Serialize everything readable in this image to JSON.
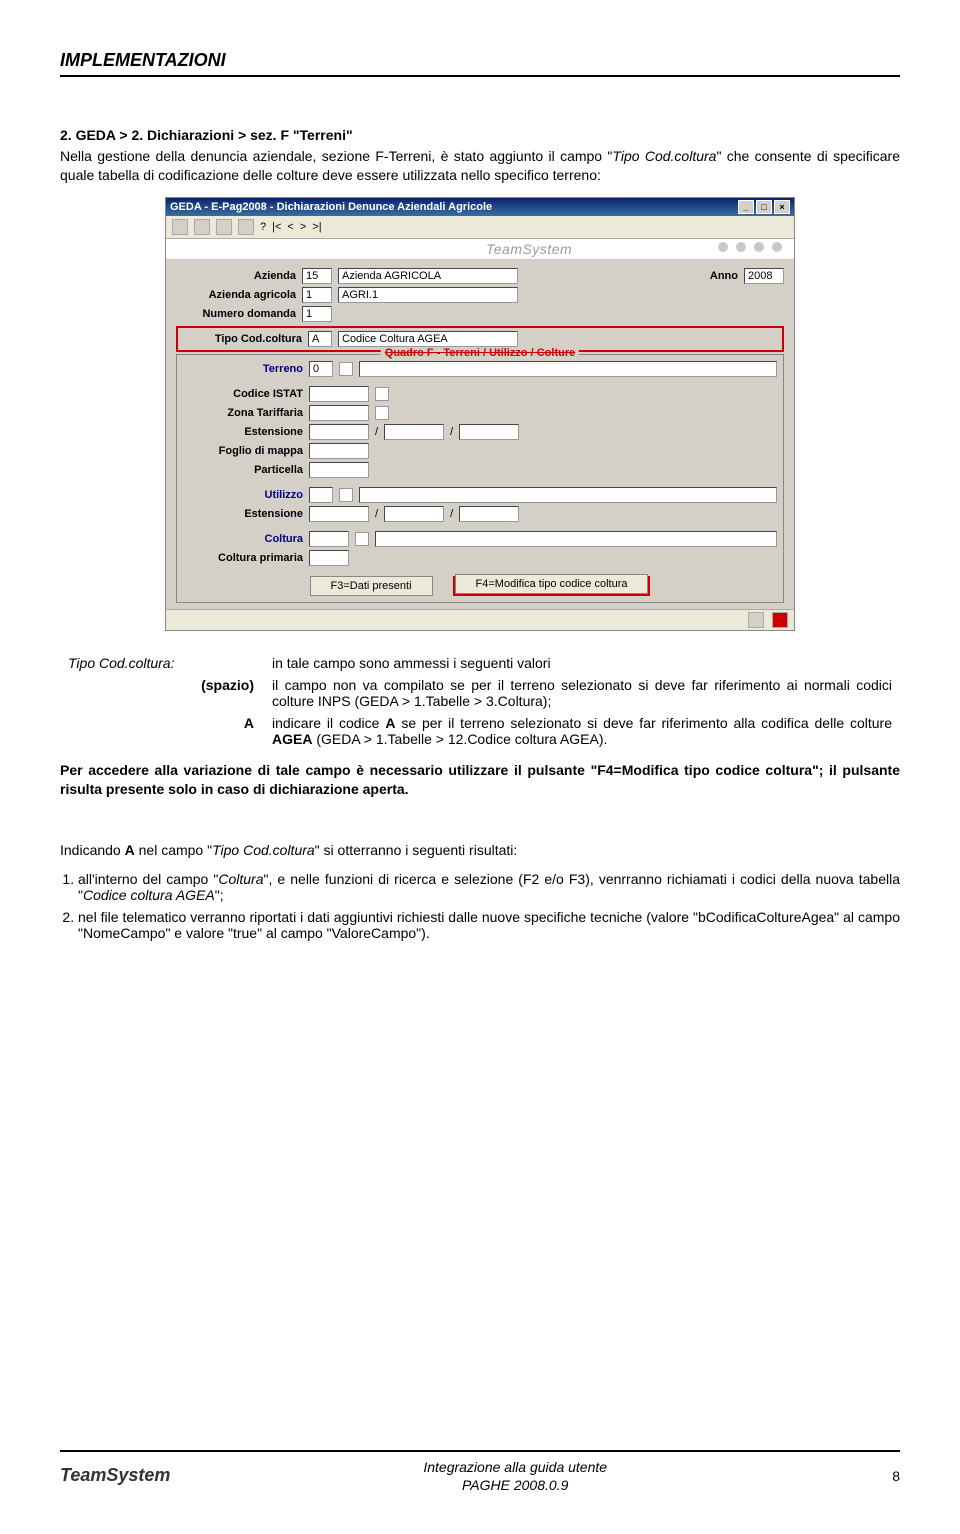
{
  "header": "IMPLEMENTAZIONI",
  "section_title": "2. GEDA > 2. Dichiarazioni > sez. F \"Terreni\"",
  "intro_1": "Nella gestione della denuncia aziendale, sezione F-Terreni, è stato aggiunto il campo \"",
  "intro_field": "Tipo Cod.coltura",
  "intro_2": "\" che consente di specificare quale tabella di codificazione delle colture deve essere utilizzata nello specifico terreno:",
  "win": {
    "title": "GEDA  - E-Pag2008  -  Dichiarazioni Denunce Aziendali Agricole",
    "nav": [
      "?",
      "|<",
      "<",
      ">",
      ">|"
    ],
    "brand": "TeamSystem",
    "anno_label": "Anno",
    "anno_value": "2008",
    "labels": {
      "azienda": "Azienda",
      "azienda_agricola": "Azienda agricola",
      "numero_domanda": "Numero domanda",
      "tipo_cod_coltura": "Tipo Cod.coltura",
      "group_title": "Quadro F - Terreni / Utilizzo / Colture",
      "terreno": "Terreno",
      "codice_istat": "Codice ISTAT",
      "zona_tariffaria": "Zona Tariffaria",
      "estensione": "Estensione",
      "foglio": "Foglio di mappa",
      "particella": "Particella",
      "utilizzo": "Utilizzo",
      "estensione2": "Estensione",
      "coltura": "Coltura",
      "coltura_primaria": "Coltura primaria"
    },
    "values": {
      "azienda": "15",
      "azienda_name": "Azienda AGRICOLA",
      "azienda_agricola": "1",
      "azienda_agricola_name": "AGRI.1",
      "numero_domanda": "1",
      "tipo_cod_coltura": "A",
      "tipo_cod_coltura_desc": "Codice Coltura AGEA",
      "terreno": "0"
    },
    "buttons": {
      "f3": "F3=Dati presenti",
      "f4": "F4=Modifica tipo codice coltura"
    }
  },
  "def": {
    "label": "Tipo Cod.coltura:",
    "row0_text": "in tale campo sono ammessi i seguenti valori",
    "row1_key": "(spazio)",
    "row1_text": "il campo non va compilato se per il terreno selezionato si deve far riferimento ai normali codici colture INPS (GEDA > 1.Tabelle > 3.Coltura);",
    "row2_key": "A",
    "row2_text_a": "indicare il codice ",
    "row2_text_b": " se per il terreno selezionato si deve far riferimento alla codifica delle colture ",
    "row2_agea": "AGEA",
    "row2_text_c": " (GEDA > 1.Tabelle > 12.Codice coltura AGEA)."
  },
  "para2_a": "Per accedere alla variazione di tale campo è necessario utilizzare il pulsante ",
  "para2_btn": "\"F4=Modifica tipo codice coltura\"",
  "para2_b": "; il pulsante risulta presente solo in caso di dichiarazione aperta.",
  "para3_a": "Indicando ",
  "para3_b": " nel campo \"",
  "para3_field": "Tipo Cod.coltura",
  "para3_c": "\" si otterranno i seguenti risultati:",
  "list": [
    {
      "a": "all'interno del campo \"",
      "i1": "Coltura",
      "b": "\", e nelle funzioni di ricerca e selezione (F2 e/o F3), venrranno richiamati i codici della nuova tabella \"",
      "i2": "Codice coltura AGEA",
      "c": "\";"
    },
    {
      "text": "nel file telematico verranno riportati i dati aggiuntivi richiesti dalle nuove specifiche tecniche (valore \"bCodificaColtureAgea\" al campo \"NomeCampo\" e valore \"true\" al campo \"ValoreCampo\")."
    }
  ],
  "footer": {
    "logo": "TeamSystem",
    "line1": "Integrazione alla guida utente",
    "line2": "PAGHE 2008.0.9",
    "page": "8"
  }
}
